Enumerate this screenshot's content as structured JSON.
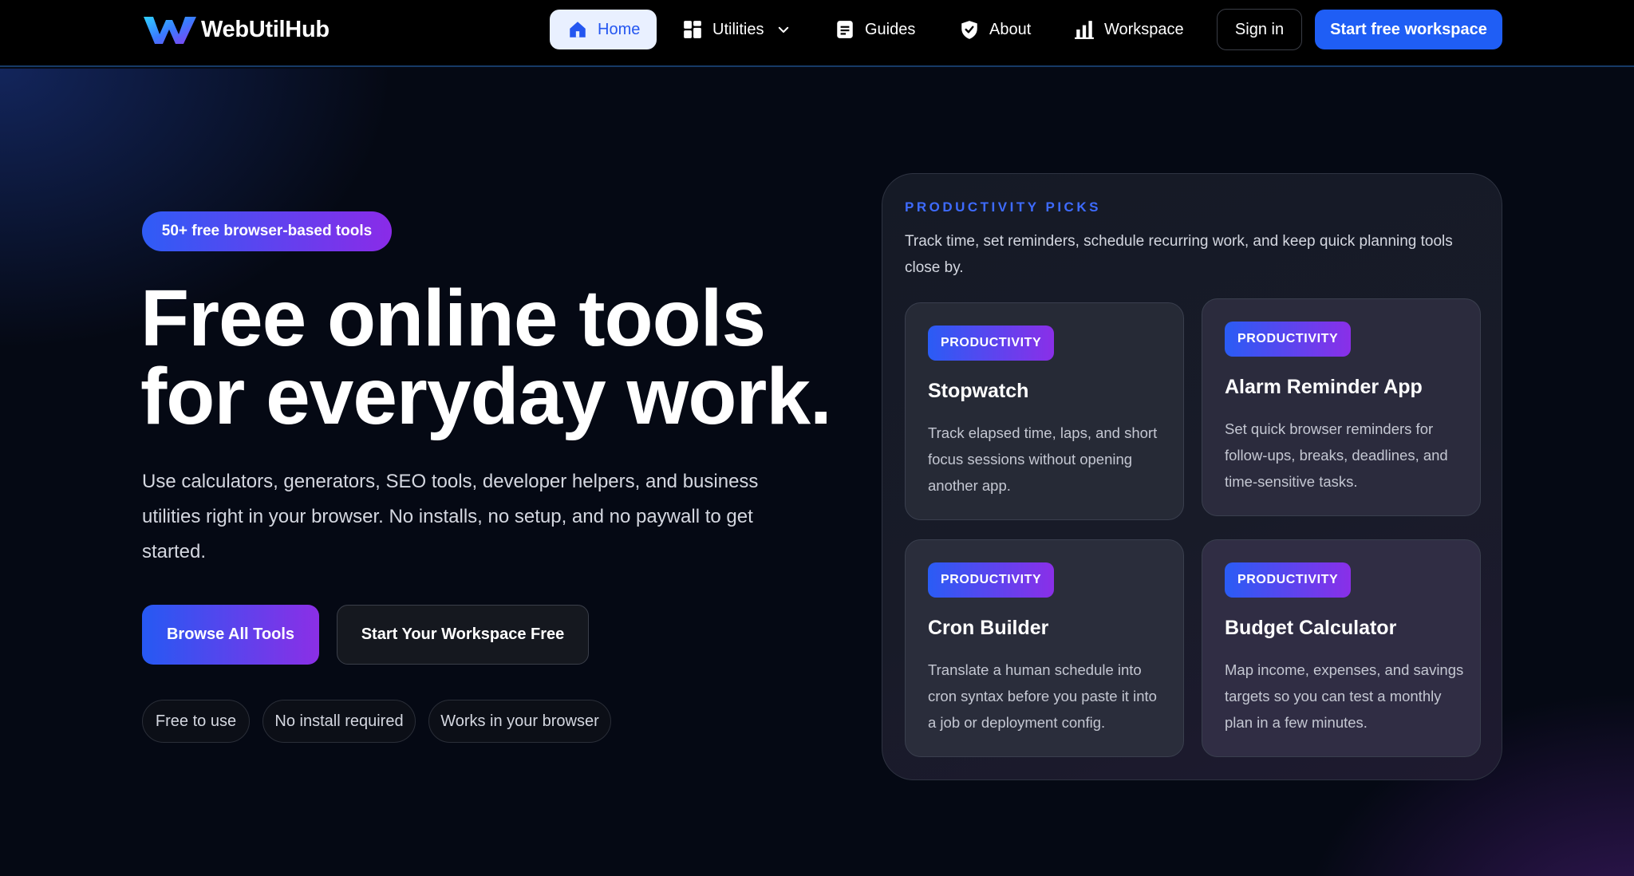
{
  "brand": {
    "name": "WebUtilHub",
    "logo_icon": "w-logo-icon"
  },
  "nav": {
    "items": [
      {
        "label": "Home",
        "icon": "home-icon"
      },
      {
        "label": "Utilities",
        "icon": "grid-icon"
      },
      {
        "label": "Guides",
        "icon": "document-icon"
      },
      {
        "label": "About",
        "icon": "shield-icon"
      },
      {
        "label": "Workspace",
        "icon": "bar-chart-icon"
      }
    ],
    "sign_in": "Sign in",
    "cta": "Start free workspace"
  },
  "hero": {
    "pill": "50+ free browser-based tools",
    "headline_line1": "Free online tools",
    "headline_line2": "for everyday work.",
    "subtext": "Use calculators, generators, SEO tools, developer helpers, and business utilities right in your browser. No installs, no setup, and no paywall to get started.",
    "primary_button": "Browse All Tools",
    "secondary_button": "Start Your Workspace Free",
    "chips": [
      "Free to use",
      "No install required",
      "Works in your browser"
    ]
  },
  "picks": {
    "eyebrow": "PRODUCTIVITY PICKS",
    "description": "Track time, set reminders, schedule recurring work, and keep quick planning tools close by.",
    "cards": [
      {
        "badge": "PRODUCTIVITY",
        "title": "Stopwatch",
        "description": "Track elapsed time, laps, and short focus sessions without opening another app."
      },
      {
        "badge": "PRODUCTIVITY",
        "title": "Alarm Reminder App",
        "description": "Set quick browser reminders for follow-ups, breaks, deadlines, and time-sensitive tasks."
      },
      {
        "badge": "PRODUCTIVITY",
        "title": "Cron Builder",
        "description": "Translate a human schedule into cron syntax before you paste it into a job or deployment config."
      },
      {
        "badge": "PRODUCTIVITY",
        "title": "Budget Calculator",
        "description": "Map income, expenses, and savings targets so you can test a monthly plan in a few minutes."
      }
    ]
  },
  "colors": {
    "accent_blue": "#1f5ef5",
    "accent_purple": "#8a2be8",
    "eyebrow_blue": "#3e6bff",
    "background": "#050914"
  }
}
